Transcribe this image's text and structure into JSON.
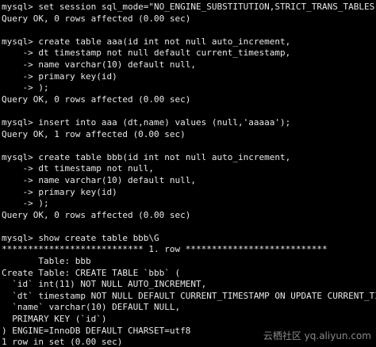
{
  "terminal": {
    "lines": [
      "mysql> set session sql_mode=\"NO_ENGINE_SUBSTITUTION,STRICT_TRANS_TABLES\";",
      "Query OK, 0 rows affected (0.00 sec)",
      "",
      "mysql> create table aaa(id int not null auto_increment,",
      "    -> dt timestamp not null default current_timestamp,",
      "    -> name varchar(10) default null,",
      "    -> primary key(id)",
      "    -> );",
      "Query OK, 0 rows affected (0.00 sec)",
      "",
      "mysql> insert into aaa (dt,name) values (null,'aaaaa');",
      "Query OK, 1 row affected (0.00 sec)",
      "",
      "mysql> create table bbb(id int not null auto_increment,",
      "    -> dt timestamp not null,",
      "    -> name varchar(10) default null,",
      "    -> primary key(id)",
      "    -> );",
      "Query OK, 0 rows affected (0.00 sec)",
      "",
      "mysql> show create table bbb\\G",
      "*************************** 1. row ***************************",
      "       Table: bbb",
      "Create Table: CREATE TABLE `bbb` (",
      "  `id` int(11) NOT NULL AUTO_INCREMENT,",
      "  `dt` timestamp NOT NULL DEFAULT CURRENT_TIMESTAMP ON UPDATE CURRENT_TIMESTAMP,",
      "  `name` varchar(10) DEFAULT NULL,",
      "  PRIMARY KEY (`id`)",
      ") ENGINE=InnoDB DEFAULT CHARSET=utf8",
      "1 row in set (0.00 sec)"
    ],
    "watermark": "云栖社区 yq.aliyun.com"
  },
  "colors": {
    "background": "#000000",
    "text": "#e8e8e8",
    "watermark": "#9a9a9a"
  }
}
